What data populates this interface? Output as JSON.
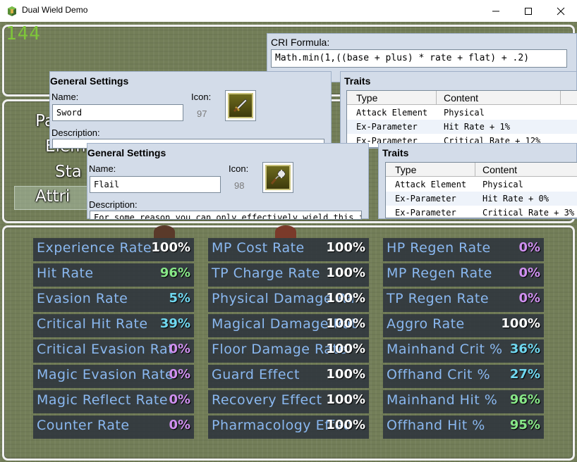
{
  "window": {
    "title": "Dual Wield Demo",
    "icon": "app-icon",
    "controls": [
      "minimize-icon",
      "maximize-icon",
      "close-icon"
    ]
  },
  "fps": "144",
  "menu": {
    "commands": [
      "Pa",
      "Elem",
      "Sta",
      "Attri"
    ],
    "selected": "Attri"
  },
  "formula": {
    "label": "CRI Formula:",
    "value": "Math.min(1,((base + plus) * rate + flat) + .2)"
  },
  "weapon1": {
    "general": {
      "title": "General Settings",
      "name_label": "Name:",
      "name_value": "Sword",
      "icon_label": "Icon:",
      "icon_index": "97",
      "icon": "sword-icon",
      "description_label": "Description:"
    },
    "traits": {
      "title": "Traits",
      "headers": [
        "Type",
        "Content"
      ],
      "rows": [
        [
          "Attack Element",
          "Physical"
        ],
        [
          "Ex-Parameter",
          "Hit Rate + 1%"
        ],
        [
          "Ex-Parameter",
          "Critical Rate + 12%"
        ]
      ]
    }
  },
  "weapon2": {
    "general": {
      "title": "General Settings",
      "name_label": "Name:",
      "name_value": "Flail",
      "icon_label": "Icon:",
      "icon_index": "98",
      "icon": "flail-icon",
      "description_label": "Description:",
      "description_value": "For some reason you can only effectively wield this in"
    },
    "traits": {
      "title": "Traits",
      "headers": [
        "Type",
        "Content"
      ],
      "rows": [
        [
          "Attack Element",
          "Physical"
        ],
        [
          "Ex-Parameter",
          "Hit Rate + 0%"
        ],
        [
          "Ex-Parameter",
          "Critical Rate + 3%"
        ]
      ]
    }
  },
  "stats": {
    "colors": {
      "label": "#8ab8f0",
      "white": "#ffffff",
      "green": "#88e888",
      "cyan": "#70d8f0",
      "purple": "#d090f0"
    },
    "columns": [
      [
        {
          "name": "Experience Rate",
          "value": "100%",
          "color": "white"
        },
        {
          "name": "Hit Rate",
          "value": "96%",
          "color": "green"
        },
        {
          "name": "Evasion Rate",
          "value": "5%",
          "color": "cyan"
        },
        {
          "name": "Critical Hit Rate",
          "value": "39%",
          "color": "cyan"
        },
        {
          "name": "Critical Evasion Rat",
          "value": "0%",
          "color": "purple"
        },
        {
          "name": "Magic Evasion Rate",
          "value": "0%",
          "color": "purple"
        },
        {
          "name": "Magic Reflect Rate",
          "value": "0%",
          "color": "purple"
        },
        {
          "name": "Counter Rate",
          "value": "0%",
          "color": "purple"
        }
      ],
      [
        {
          "name": "MP Cost Rate",
          "value": "100%",
          "color": "white"
        },
        {
          "name": "TP Charge Rate",
          "value": "100%",
          "color": "white"
        },
        {
          "name": "Physical Damage Ra",
          "value": "100%",
          "color": "white"
        },
        {
          "name": "Magical Damage Rat",
          "value": "100%",
          "color": "white"
        },
        {
          "name": "Floor Damage Rate",
          "value": "100%",
          "color": "white"
        },
        {
          "name": "Guard Effect",
          "value": "100%",
          "color": "white"
        },
        {
          "name": "Recovery Effect",
          "value": "100%",
          "color": "white"
        },
        {
          "name": "Pharmacology Effec",
          "value": "100%",
          "color": "white"
        }
      ],
      [
        {
          "name": "HP Regen Rate",
          "value": "0%",
          "color": "purple"
        },
        {
          "name": "MP Regen Rate",
          "value": "0%",
          "color": "purple"
        },
        {
          "name": "TP Regen Rate",
          "value": "0%",
          "color": "purple"
        },
        {
          "name": "Aggro Rate",
          "value": "100%",
          "color": "white"
        },
        {
          "name": "Mainhand Crit %",
          "value": "36%",
          "color": "cyan"
        },
        {
          "name": "Offhand Crit %",
          "value": "27%",
          "color": "cyan"
        },
        {
          "name": "Mainhand Hit %",
          "value": "96%",
          "color": "green"
        },
        {
          "name": "Offhand Hit %",
          "value": "95%",
          "color": "green"
        }
      ]
    ]
  }
}
